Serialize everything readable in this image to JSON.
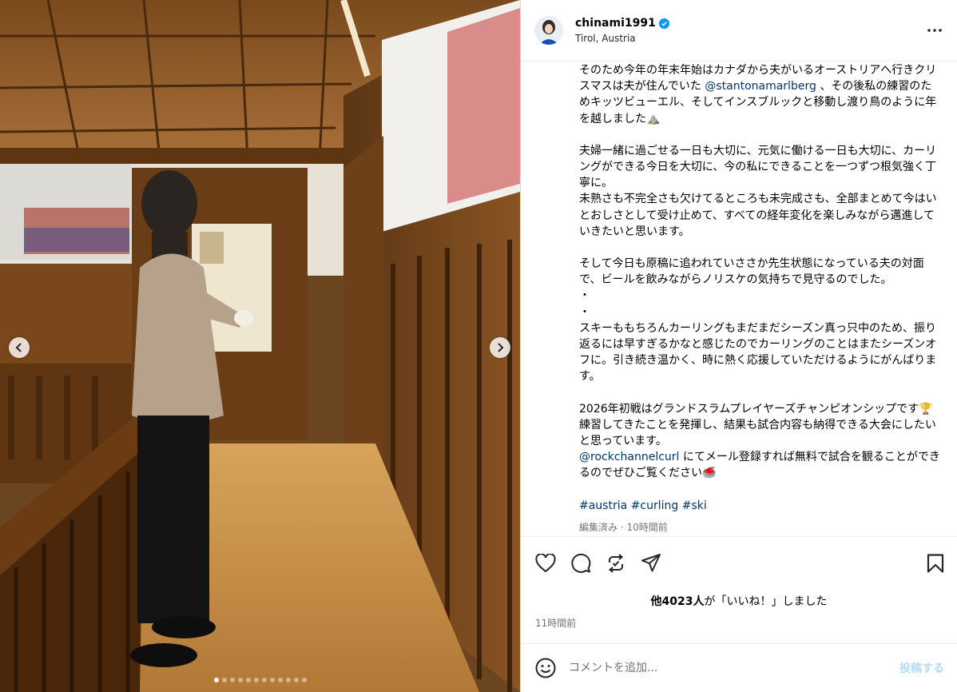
{
  "header": {
    "username": "chinami1991",
    "location": "Tirol, Austria"
  },
  "caption": {
    "p1_a": "そのため今年の年末年始はカナダから夫がいるオーストリアへ行きクリスマスは夫が住んでいた",
    "p1_mention": "@stantonamarlberg",
    "p1_b": "、その後私の練習のためキッツビューエル、そしてインスブルックと移動し渡り鳥のように年を越しました⛰️",
    "p2": "夫婦一緒に過ごせる一日も大切に、元気に働ける一日も大切に、カーリングができる今日を大切に、今の私にできることを一つずつ根気強く丁寧に。",
    "p3": "未熟さも不完全さも欠けてるところも未完成さも、全部まとめて今はいとおしさとして受け止めて、すべての経年変化を楽しみながら邁進していきたいと思います。",
    "p4": "そして今日も原稿に追われていささか先生状態になっている夫の対面で、ビールを飲みながらノリスケの気持ちで見守るのでした。",
    "dot1": "・",
    "dot2": "・",
    "p5": "スキーももちろんカーリングもまだまだシーズン真っ只中のため、振り返るには早すぎるかなと感じたのでカーリングのことはまたシーズンオフに。引き続き温かく、時に熱く応援していただけるようにがんばります。",
    "p6": "2026年初戦はグランドスラムプレイヤーズチャンピオンシップです🏆練習してきたことを発揮し、結果も試合内容も納得できる大会にしたいと思っています。",
    "p7_mention": "@rockchannelcurl",
    "p7_b": "にてメール登録すれば無料で試合を観ることができるのでぜひご覧ください🥌",
    "hashtags": [
      "#austria",
      "#curling",
      "#ski"
    ],
    "meta": "編集済み · 10時間前"
  },
  "likes": {
    "count": "他4023人",
    "suffix": "が「いいね！」しました"
  },
  "posted_time": "11時間前",
  "comment": {
    "placeholder": "コメントを追加...",
    "post_label": "投稿する"
  },
  "carousel": {
    "total": 12,
    "active_index": 0
  },
  "colors": {
    "link": "#00376b",
    "verified": "#0095f6",
    "post_button_disabled": "#b3dbff"
  },
  "icons": [
    "verified-badge-icon",
    "more-options-icon",
    "heart-icon",
    "comment-icon",
    "repost-icon",
    "share-icon",
    "bookmark-icon",
    "emoji-icon",
    "chevron-left-icon",
    "chevron-right-icon"
  ]
}
